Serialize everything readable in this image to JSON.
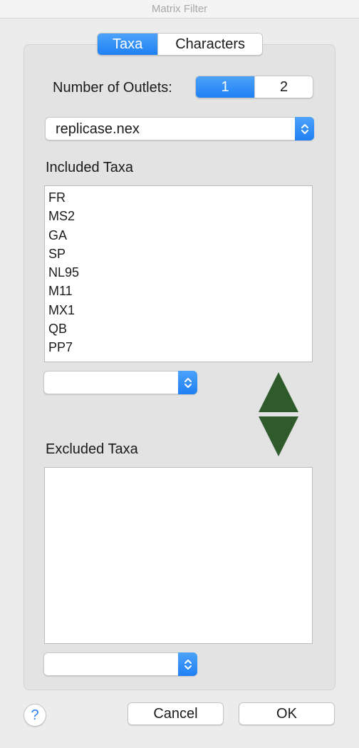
{
  "window": {
    "title": "Matrix Filter"
  },
  "tabs": [
    {
      "label": "Taxa",
      "active": true
    },
    {
      "label": "Characters",
      "active": false
    }
  ],
  "outlets": {
    "label": "Number of Outlets:",
    "options": [
      "1",
      "2"
    ],
    "selected": "1"
  },
  "file_popup": {
    "value": "replicase.nex"
  },
  "included": {
    "label": "Included Taxa",
    "items": [
      "FR",
      "MS2",
      "GA",
      "SP",
      "NL95",
      "M11",
      "MX1",
      "QB",
      "PP7"
    ],
    "popup_value": ""
  },
  "excluded": {
    "label": "Excluded Taxa",
    "items": [],
    "popup_value": ""
  },
  "icons": {
    "move_up": "triangle-up-icon",
    "move_down": "triangle-down-icon",
    "help": "question-icon",
    "stepper": "chevron-updown-icon"
  },
  "colors": {
    "accent": "#1f80f3",
    "arrow": "#2e5a2c"
  },
  "buttons": {
    "help": "?",
    "cancel": "Cancel",
    "ok": "OK"
  }
}
